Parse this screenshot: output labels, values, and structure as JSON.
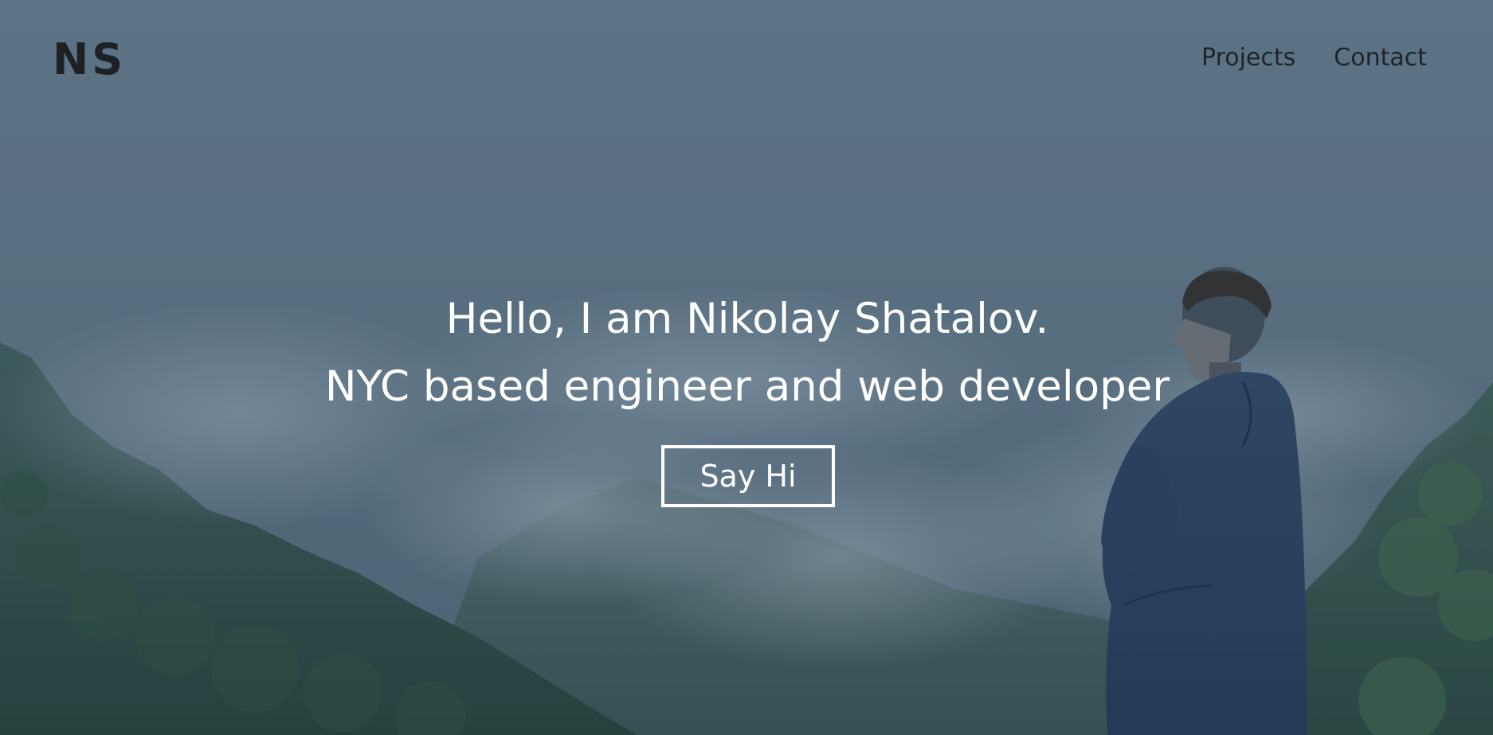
{
  "header": {
    "logo": "NS",
    "nav": [
      {
        "label": "Projects"
      },
      {
        "label": "Contact"
      }
    ]
  },
  "hero": {
    "line1": "Hello, I am Nikolay Shatalov.",
    "line2": "NYC based engineer and web developer",
    "cta_label": "Say Hi"
  },
  "colors": {
    "sky": "#5f7686",
    "mountain": "#2d4a43",
    "jacket": "#243a55",
    "text_light": "#ffffff",
    "text_dark": "#1e2124"
  }
}
